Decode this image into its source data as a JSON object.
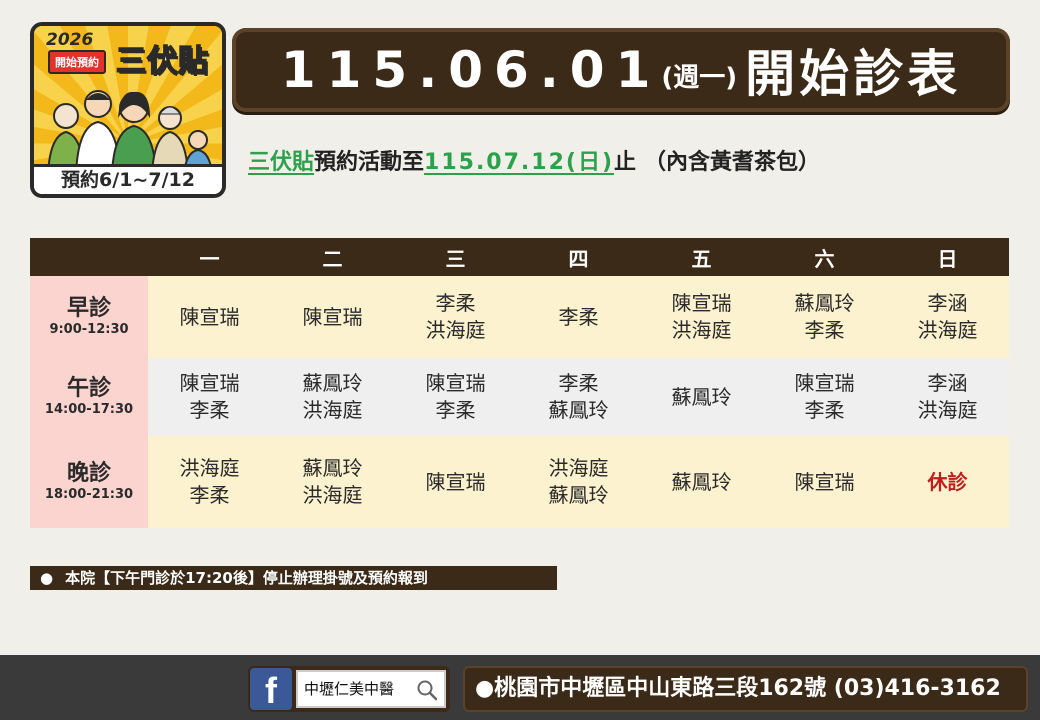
{
  "promo": {
    "year": "2026",
    "tag": "開始預約",
    "title": "三伏貼",
    "footer": "預約6/1~7/12"
  },
  "title": {
    "date": "115.06.01",
    "weekday": "(週一)",
    "text": "開始診表"
  },
  "subtitle": {
    "campaign": "三伏貼",
    "mid": "預約活動至",
    "end_date": "115.07.12(日)",
    "stop": "止",
    "note": "（內含黃耆茶包）"
  },
  "schedule": {
    "days": [
      "一",
      "二",
      "三",
      "四",
      "五",
      "六",
      "日"
    ],
    "rows": [
      {
        "name": "早診",
        "time": "9:00-12:30",
        "cells": [
          [
            "陳宣瑞"
          ],
          [
            "陳宣瑞"
          ],
          [
            "李柔",
            "洪海庭"
          ],
          [
            "李柔"
          ],
          [
            "陳宣瑞",
            "洪海庭"
          ],
          [
            "蘇鳳玲",
            "李柔"
          ],
          [
            "李涵",
            "洪海庭"
          ]
        ]
      },
      {
        "name": "午診",
        "time": "14:00-17:30",
        "cells": [
          [
            "陳宣瑞",
            "李柔"
          ],
          [
            "蘇鳳玲",
            "洪海庭"
          ],
          [
            "陳宣瑞",
            "李柔"
          ],
          [
            "李柔",
            "蘇鳳玲"
          ],
          [
            "蘇鳳玲"
          ],
          [
            "陳宣瑞",
            "李柔"
          ],
          [
            "李涵",
            "洪海庭"
          ]
        ]
      },
      {
        "name": "晚診",
        "time": "18:00-21:30",
        "cells": [
          [
            "洪海庭",
            "李柔"
          ],
          [
            "蘇鳳玲",
            "洪海庭"
          ],
          [
            "陳宣瑞"
          ],
          [
            "洪海庭",
            "蘇鳳玲"
          ],
          [
            "蘇鳳玲"
          ],
          [
            "陳宣瑞"
          ],
          [
            "休診"
          ]
        ]
      }
    ]
  },
  "notice": {
    "bullet": "●",
    "text": "本院【下午門診於17:20後】停止辦理掛號及預約報到"
  },
  "footer": {
    "fb_letter": "f",
    "search_text": "中壢仁美中醫",
    "address": "●桃園市中壢區中山東路三段162號 (03)416-3162"
  },
  "colors": {
    "brown": "#3b2a17",
    "green": "#2aa14a",
    "closed_red": "#c11d1d",
    "period_pink": "#fbd4d0",
    "cell_cream": "#fdf2cf",
    "cell_gray": "#efefef"
  },
  "icons": [
    "facebook-icon",
    "search-icon"
  ]
}
